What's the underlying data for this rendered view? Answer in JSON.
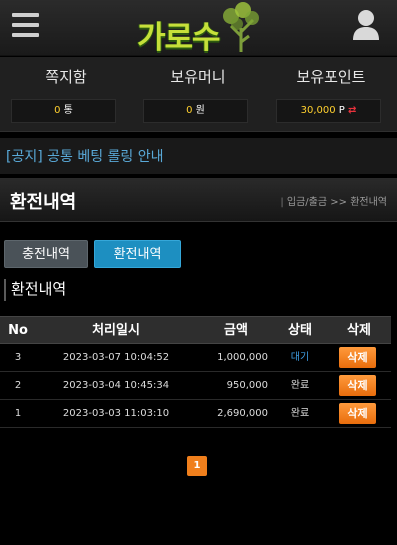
{
  "header": {
    "logo_text": "가로수",
    "colors": {
      "logo": "#c6e03a",
      "accent": "#1d8fc1",
      "button": "#f07f1c"
    }
  },
  "wallet": {
    "items": [
      {
        "label": "쪽지함",
        "value": "0",
        "unit": "통"
      },
      {
        "label": "보유머니",
        "value": "0",
        "unit": "원"
      },
      {
        "label": "보유포인트",
        "value": "30,000",
        "unit": "P",
        "action_icon": "⇄"
      }
    ]
  },
  "notice": {
    "text": "[공지] 공통 베팅 롤링 안내"
  },
  "page": {
    "title": "환전내역",
    "breadcrumb": {
      "separator": "|",
      "parent": "입금/출금",
      "arrow": ">>",
      "current": "환전내역"
    }
  },
  "tabs": [
    {
      "label": "충전내역",
      "active": false
    },
    {
      "label": "환전내역",
      "active": true
    }
  ],
  "section_title": "환전내역",
  "table": {
    "headers": {
      "no": "No",
      "date": "처리일시",
      "amount": "금액",
      "status": "상태",
      "delete": "삭제"
    },
    "rows": [
      {
        "no": "3",
        "date": "2023-03-07 10:04:52",
        "amount": "1,000,000",
        "status": "대기",
        "delete": "삭제"
      },
      {
        "no": "2",
        "date": "2023-03-04 10:45:34",
        "amount": "950,000",
        "status": "완료",
        "delete": "삭제"
      },
      {
        "no": "1",
        "date": "2023-03-03 11:03:10",
        "amount": "2,690,000",
        "status": "완료",
        "delete": "삭제"
      }
    ]
  },
  "pagination": {
    "current": "1"
  }
}
